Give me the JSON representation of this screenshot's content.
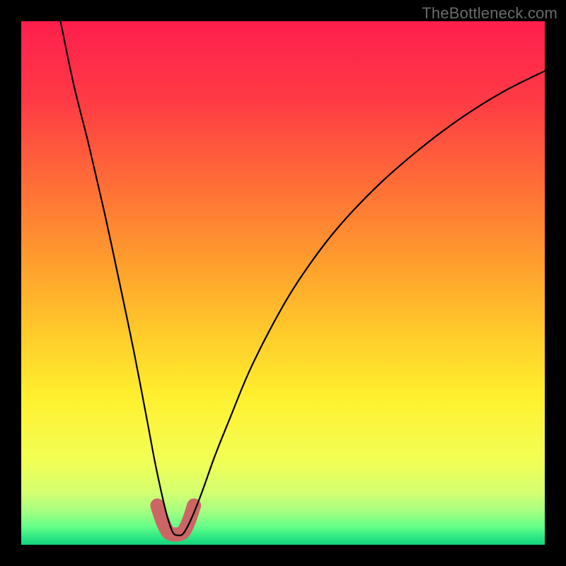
{
  "watermark": "TheBottleneck.com",
  "chart_data": {
    "type": "line",
    "title": "",
    "xlabel": "",
    "ylabel": "",
    "xlim": [
      0,
      1
    ],
    "ylim": [
      0,
      1
    ],
    "series": [
      {
        "name": "curve",
        "color": "#000000",
        "x": [
          0.075,
          0.1,
          0.13,
          0.16,
          0.19,
          0.215,
          0.24,
          0.255,
          0.27,
          0.28,
          0.29,
          0.3,
          0.31,
          0.325,
          0.345,
          0.37,
          0.4,
          0.435,
          0.48,
          0.53,
          0.6,
          0.68,
          0.76,
          0.84,
          0.92,
          1.0
        ],
        "y": [
          1.0,
          0.88,
          0.76,
          0.63,
          0.49,
          0.37,
          0.24,
          0.16,
          0.09,
          0.05,
          0.023,
          0.018,
          0.022,
          0.05,
          0.1,
          0.17,
          0.245,
          0.33,
          0.42,
          0.505,
          0.6,
          0.685,
          0.755,
          0.815,
          0.865,
          0.905
        ]
      },
      {
        "name": "highlight",
        "color": "#cc6666",
        "x": [
          0.26,
          0.27,
          0.28,
          0.29,
          0.3,
          0.31,
          0.32,
          0.33
        ],
        "y": [
          0.075,
          0.045,
          0.025,
          0.02,
          0.02,
          0.025,
          0.045,
          0.075
        ]
      }
    ],
    "background_gradient": {
      "type": "vertical",
      "stops": [
        {
          "pos": 0.0,
          "color": "#ff1f4d"
        },
        {
          "pos": 0.15,
          "color": "#ff3a45"
        },
        {
          "pos": 0.3,
          "color": "#ff6a38"
        },
        {
          "pos": 0.45,
          "color": "#ff9a2e"
        },
        {
          "pos": 0.6,
          "color": "#ffcc2a"
        },
        {
          "pos": 0.72,
          "color": "#fff02f"
        },
        {
          "pos": 0.84,
          "color": "#f2ff55"
        },
        {
          "pos": 0.9,
          "color": "#d4ff70"
        },
        {
          "pos": 0.935,
          "color": "#a6ff80"
        },
        {
          "pos": 0.965,
          "color": "#66ff88"
        },
        {
          "pos": 0.985,
          "color": "#2fe884"
        },
        {
          "pos": 1.0,
          "color": "#14d47d"
        }
      ]
    },
    "highlight_stroke_width_px": 20,
    "curve_stroke_width_px": 2.2
  }
}
